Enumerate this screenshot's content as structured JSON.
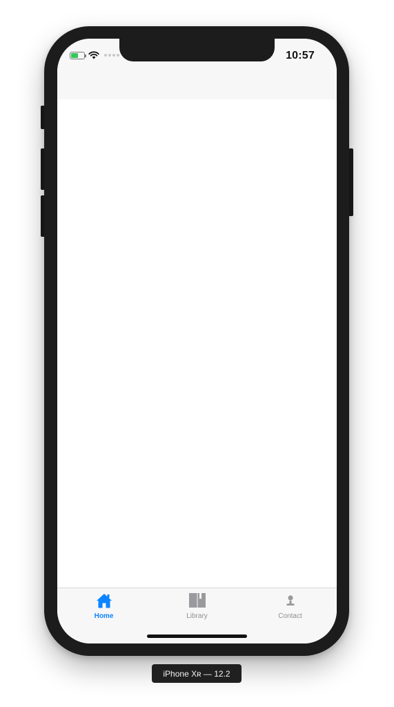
{
  "status_bar": {
    "time": "10:57"
  },
  "tab_bar": {
    "tabs": [
      {
        "label": "Home",
        "icon": "home-icon",
        "active": true
      },
      {
        "label": "Library",
        "icon": "book-icon",
        "active": false
      },
      {
        "label": "Contact",
        "icon": "person-icon",
        "active": false
      }
    ]
  },
  "simulator": {
    "device_label": "iPhone Xʀ — 12.2"
  },
  "colors": {
    "accent": "#0a84ff",
    "inactive": "#8e8e93",
    "battery": "#35c759"
  },
  "battery_level": 0.55
}
